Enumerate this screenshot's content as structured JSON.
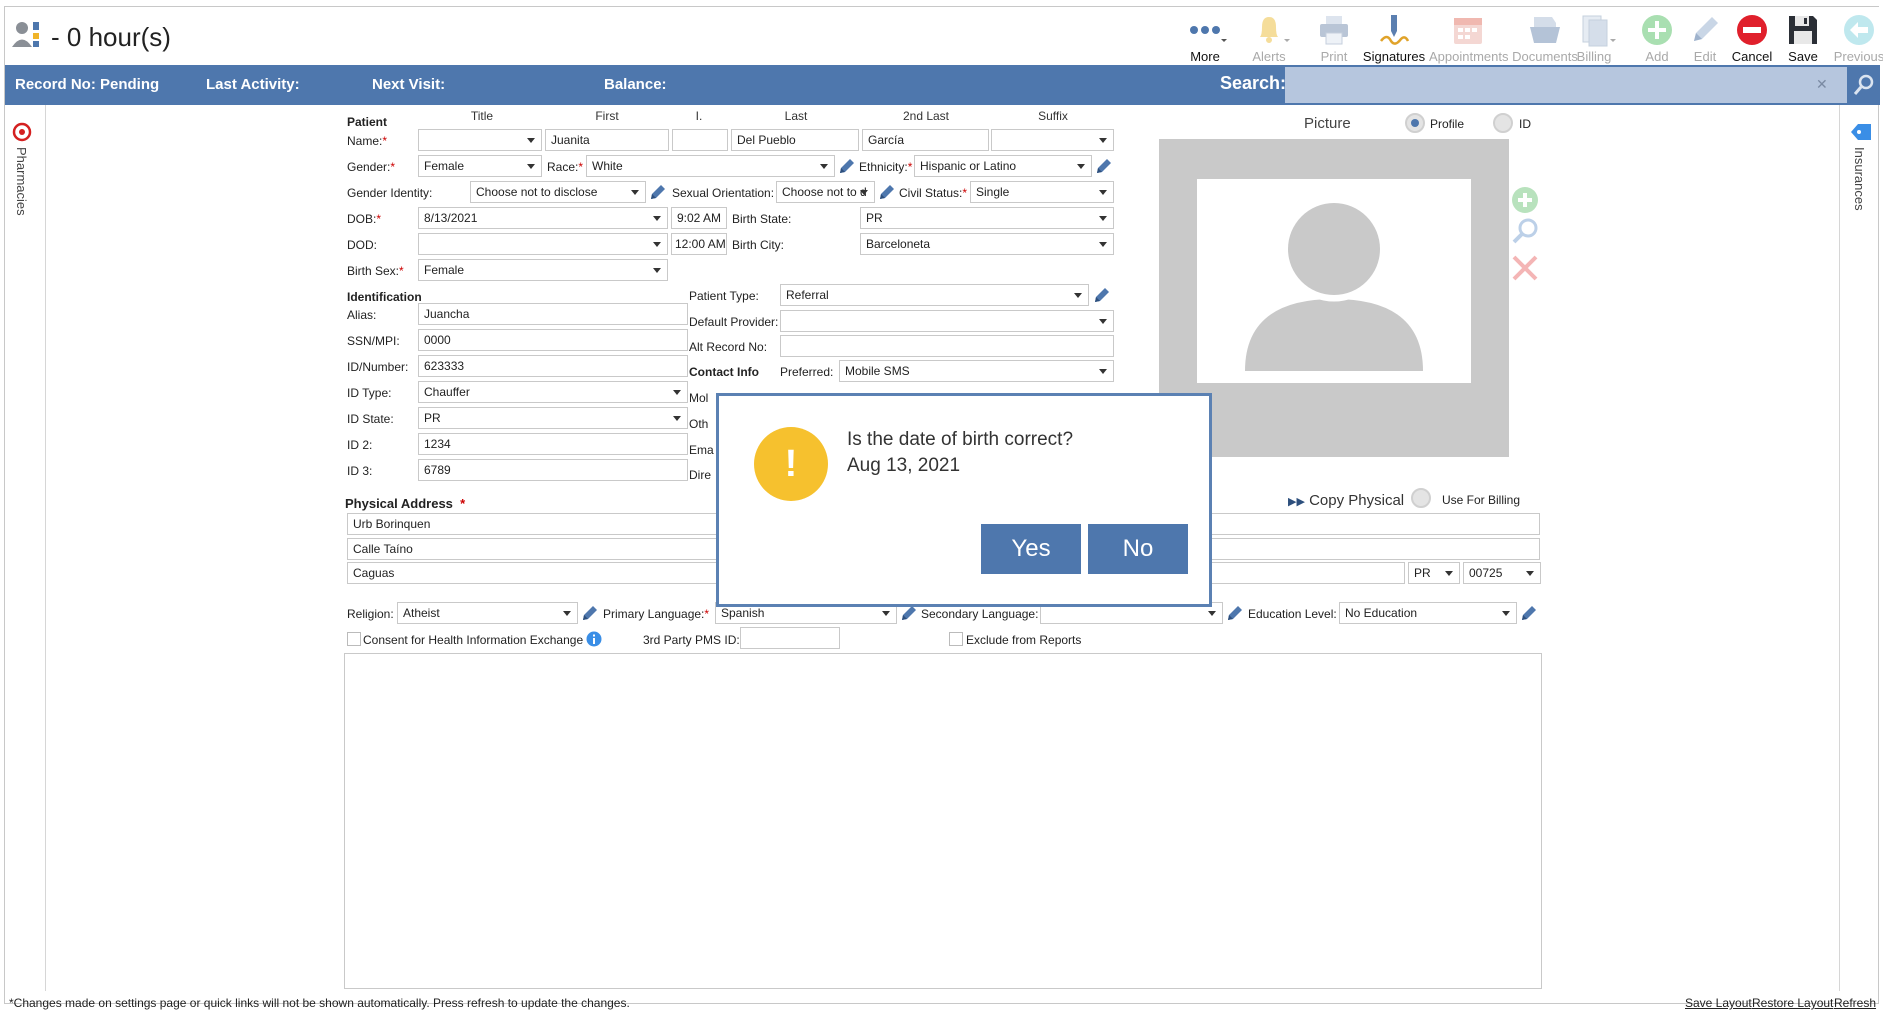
{
  "window": {
    "title": "- 0 hour(s)"
  },
  "toolbar": {
    "more": "More",
    "alerts": "Alerts",
    "print": "Print",
    "signatures": "Signatures",
    "appointments": "Appointments",
    "documents": "Documents",
    "billing": "Billing",
    "add": "Add",
    "edit": "Edit",
    "cancel": "Cancel",
    "save": "Save",
    "previous": "Previous"
  },
  "infobar": {
    "record_no": "Record No: Pending",
    "last_activity": "Last Activity:",
    "next_visit": "Next Visit:",
    "balance": "Balance:",
    "search_label": "Search:",
    "search_clear": "✕"
  },
  "rails": {
    "left": "Pharmacies",
    "right": "Insurances"
  },
  "patient": {
    "section": "Patient",
    "cols": {
      "title": "Title",
      "first": "First",
      "initial": "I.",
      "last": "Last",
      "second_last": "2nd Last",
      "suffix": "Suffix"
    },
    "name_label": "Name:",
    "title_value": "",
    "first": "Juanita",
    "initial": "",
    "last": "Del Pueblo",
    "second_last": "García",
    "suffix": "",
    "gender_label": "Gender:",
    "gender": "Female",
    "race_label": "Race:",
    "race": "White",
    "ethnicity_label": "Ethnicity:",
    "ethnicity": "Hispanic or Latino",
    "gender_identity_label": "Gender Identity:",
    "gender_identity": "Choose not to disclose",
    "sexual_orientation_label": "Sexual Orientation:",
    "sexual_orientation": "Choose not to d",
    "civil_status_label": "Civil Status:",
    "civil_status": "Single",
    "dob_label": "DOB:",
    "dob": "8/13/2021",
    "dob_time": "9:02 AM",
    "birth_state_label": "Birth State:",
    "birth_state": "PR",
    "dod_label": "DOD:",
    "dod": "",
    "dod_time": "12:00 AM",
    "birth_city_label": "Birth City:",
    "birth_city": "Barceloneta",
    "birth_sex_label": "Birth Sex:",
    "birth_sex": "Female"
  },
  "identification": {
    "section": "Identification",
    "alias_label": "Alias:",
    "alias": "Juancha",
    "ssn_label": "SSN/MPI:",
    "ssn": "0000",
    "idnum_label": "ID/Number:",
    "idnum": "623333",
    "idtype_label": "ID Type:",
    "idtype": "Chauffer",
    "idstate_label": "ID State:",
    "idstate": "PR",
    "id2_label": "ID 2:",
    "id2": "1234",
    "id3_label": "ID 3:",
    "id3": "6789",
    "patient_type_label": "Patient Type:",
    "patient_type": "Referral",
    "default_provider_label": "Default Provider:",
    "default_provider": "",
    "alt_record_label": "Alt Record No:",
    "alt_record": "",
    "contact_section": "Contact Info",
    "preferred_label": "Preferred:",
    "preferred": "Mobile SMS",
    "mobile_label": "Mol",
    "other_label": "Oth",
    "email_label": "Ema",
    "direct_label": "Dire"
  },
  "address": {
    "section": "Physical Address",
    "req": "*",
    "line1": "Urb Borinquen",
    "line2": "Calle Taíno",
    "city": "Caguas",
    "state": "PR",
    "zip": "00725",
    "copy_physical": "Copy Physical",
    "use_for_billing": "Use For Billing"
  },
  "misc": {
    "religion_label": "Religion:",
    "religion": "Atheist",
    "primary_language_label": "Primary Language:",
    "primary_language": "Spanish",
    "secondary_language_label": "Secondary Language:",
    "secondary_language": "",
    "education_label": "Education Level:",
    "education": "No Education",
    "consent_label": "Consent for Health Information Exchange",
    "third_party_label": "3rd Party PMS ID:",
    "third_party": "",
    "exclude_label": "Exclude from Reports"
  },
  "picture": {
    "label": "Picture",
    "profile": "Profile",
    "id": "ID"
  },
  "modal": {
    "question": "Is the date of birth correct?",
    "date": "Aug 13, 2021",
    "yes": "Yes",
    "no": "No",
    "icon": "!"
  },
  "footer": {
    "note": "*Changes made on settings page or quick links will not be shown automatically. Press refresh to update the changes.",
    "save_layout": "Save Layout",
    "restore_layout": "Restore Layout",
    "refresh": "Refresh"
  },
  "colors": {
    "accent": "#4e77ad",
    "warning": "#f6c12e",
    "cancel": "#e0202c",
    "add": "#7fcf8a"
  }
}
